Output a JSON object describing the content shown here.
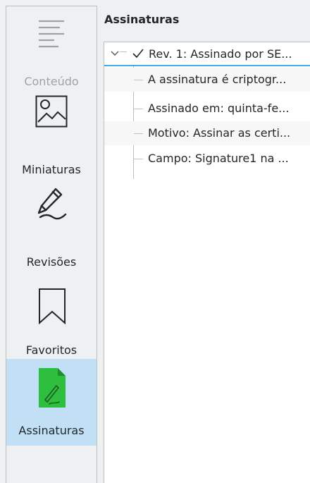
{
  "sidebar": {
    "items": [
      {
        "label": "Conteúdo",
        "icon": "table-of-contents-icon",
        "state": "disabled"
      },
      {
        "label": "Miniaturas",
        "icon": "image-icon",
        "state": "normal"
      },
      {
        "label": "Revisões",
        "icon": "pen-signature-icon",
        "state": "normal"
      },
      {
        "label": "Favoritos",
        "icon": "bookmark-icon",
        "state": "normal"
      },
      {
        "label": "Assinaturas",
        "icon": "signature-document-icon",
        "state": "selected"
      }
    ]
  },
  "panel": {
    "title": "Assinaturas",
    "tree": {
      "root": {
        "label": "Rev. 1: Assinado por SE...",
        "expanded": true,
        "verified": true
      },
      "children": [
        "A assinatura é criptogr...",
        "Assinado em: quinta-fe...",
        "Motivo: Assinar as certi...",
        "Campo: Signature1 na ..."
      ]
    }
  },
  "colors": {
    "selection": "#c2e0f5",
    "accent": "#3daee9",
    "signature_icon": "#2fbf3f"
  }
}
